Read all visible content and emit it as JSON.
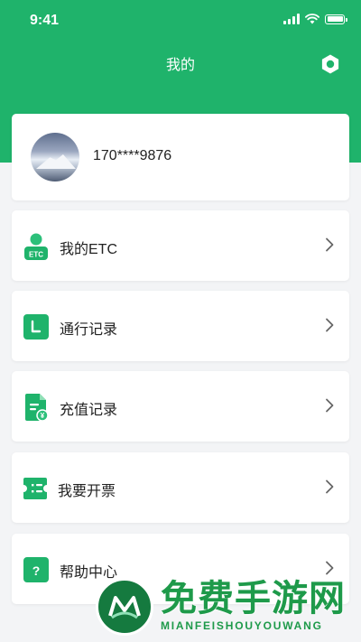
{
  "status_bar": {
    "time": "9:41"
  },
  "header": {
    "title": "我的"
  },
  "profile": {
    "phone": "170****9876"
  },
  "menu": [
    {
      "id": "my-etc",
      "label": "我的ETC",
      "icon": "etc-user-icon",
      "icon_text": "ETC"
    },
    {
      "id": "pass-records",
      "label": "通行记录",
      "icon": "pass-record-icon"
    },
    {
      "id": "recharge-records",
      "label": "充值记录",
      "icon": "recharge-doc-icon",
      "icon_text": "¥"
    },
    {
      "id": "invoice",
      "label": "我要开票",
      "icon": "invoice-ticket-icon"
    },
    {
      "id": "help-center",
      "label": "帮助中心",
      "icon": "help-question-icon",
      "icon_text": "?"
    }
  ],
  "watermark": {
    "cn": "免费手游网",
    "en": "MIANFEISHOUYOUWANG"
  },
  "colors": {
    "brand": "#1fb36b",
    "background": "#f3f4f6",
    "card": "#ffffff",
    "watermark": "#1e9a4a"
  }
}
